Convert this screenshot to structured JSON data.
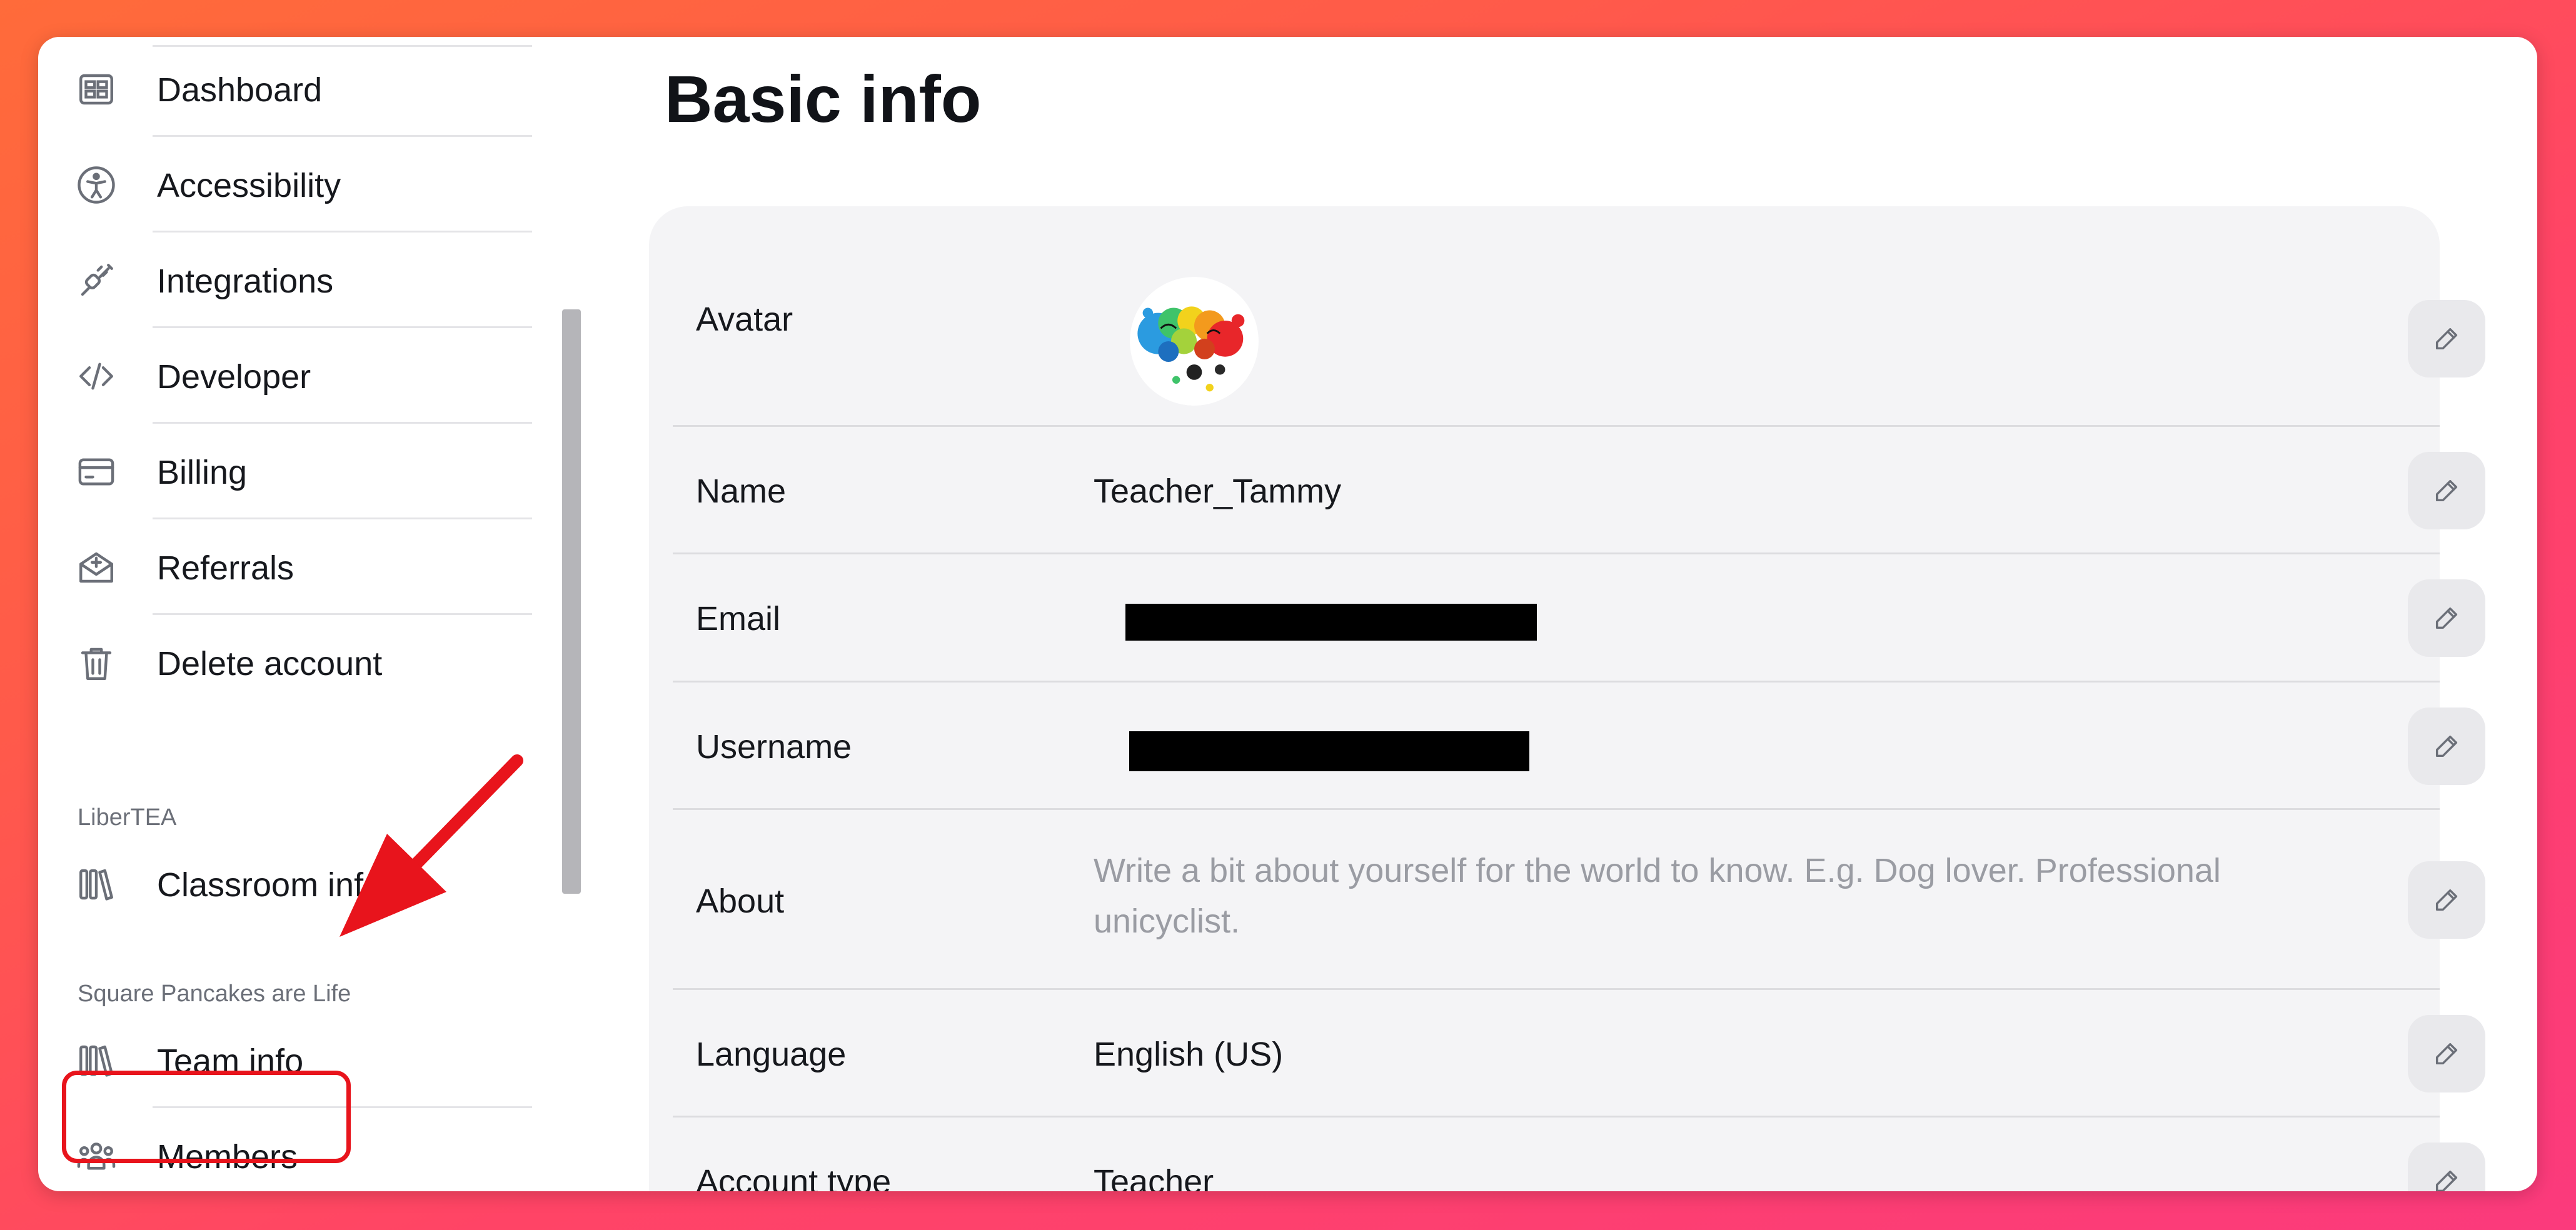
{
  "sidebar": {
    "items": [
      {
        "label": "Dashboard",
        "icon": "dashboard-icon"
      },
      {
        "label": "Accessibility",
        "icon": "accessibility-icon"
      },
      {
        "label": "Integrations",
        "icon": "plug-icon"
      },
      {
        "label": "Developer",
        "icon": "code-icon"
      },
      {
        "label": "Billing",
        "icon": "credit-card-icon"
      },
      {
        "label": "Referrals",
        "icon": "envelope-icon"
      },
      {
        "label": "Delete account",
        "icon": "trash-icon"
      }
    ],
    "section_1": {
      "title": "LiberTEA",
      "items": [
        {
          "label": "Classroom info",
          "icon": "library-icon"
        }
      ]
    },
    "section_2": {
      "title": "Square Pancakes are Life",
      "items": [
        {
          "label": "Team info",
          "icon": "library-icon"
        },
        {
          "label": "Members",
          "icon": "group-icon"
        }
      ]
    }
  },
  "main": {
    "title": "Basic info",
    "rows": [
      {
        "label": "Avatar",
        "value": ""
      },
      {
        "label": "Name",
        "value": "Teacher_Tammy"
      },
      {
        "label": "Email",
        "value": ""
      },
      {
        "label": "Username",
        "value": ""
      },
      {
        "label": "About",
        "value": "Write a bit about yourself for the world to know. E.g. Dog lover. Professional unicyclist."
      },
      {
        "label": "Language",
        "value": "English (US)"
      },
      {
        "label": "Account type",
        "value": "Teacher"
      }
    ]
  },
  "colors": {
    "annotation": "#e8141c",
    "background_start": "#ff6b3a",
    "background_end": "#fb3a7c",
    "card": "#f4f4f6"
  }
}
